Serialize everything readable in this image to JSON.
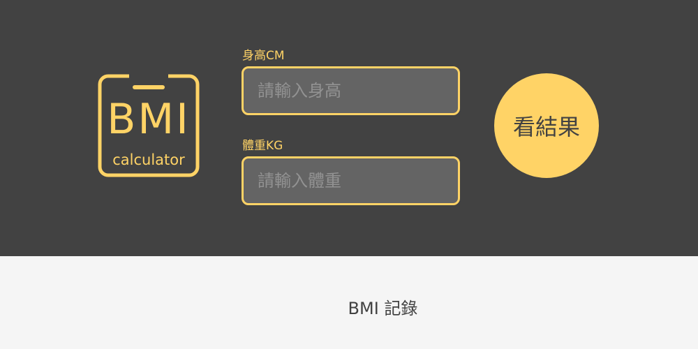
{
  "logo": {
    "title": "BMI",
    "subtitle": "calculator",
    "icon": "bmi-calculator-logo"
  },
  "form": {
    "height": {
      "label": "身高CM",
      "placeholder": "請輸入身高",
      "value": ""
    },
    "weight": {
      "label": "體重KG",
      "placeholder": "請輸入體重",
      "value": ""
    }
  },
  "result_button": {
    "label": "看結果"
  },
  "records": {
    "title": "BMI 記錄"
  },
  "colors": {
    "accent": "#ffd366",
    "header_bg": "#424242",
    "page_bg": "#f5f5f5",
    "text_dark": "#424242"
  }
}
